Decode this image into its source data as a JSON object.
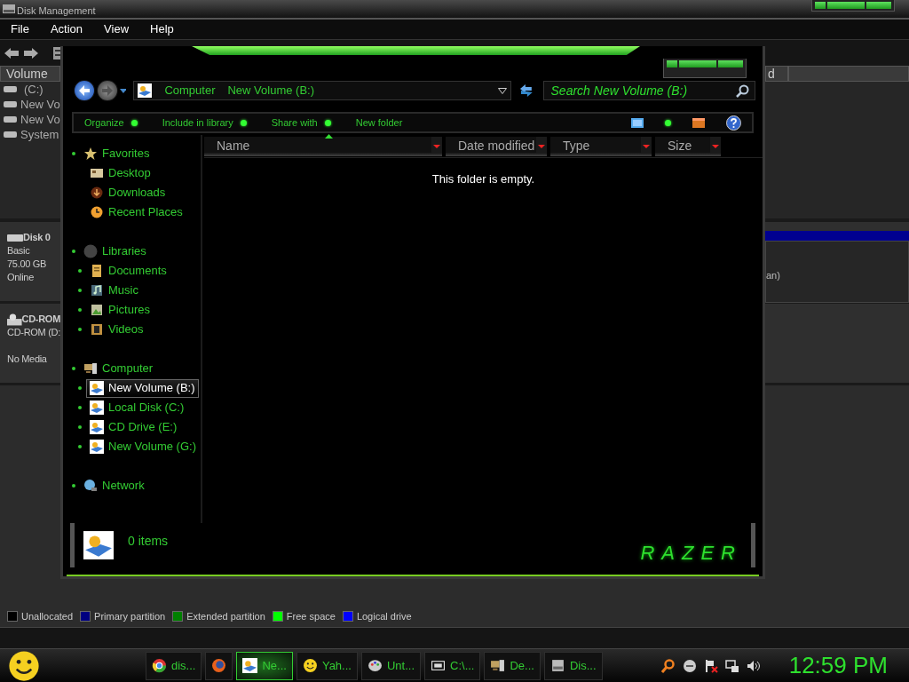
{
  "disk_management": {
    "title": "Disk Management",
    "menu": [
      "File",
      "Action",
      "View",
      "Help"
    ],
    "volume_columns": [
      "Volume",
      "d"
    ],
    "volumes": [
      "(C:)",
      "New Vo",
      "New Vo",
      "System"
    ],
    "disks": [
      {
        "name": "Disk 0",
        "kind": "disk",
        "type": "Basic",
        "size": "75.00 GB",
        "status": "Online",
        "partition_text": "an)"
      },
      {
        "name": "CD-ROM",
        "kind": "cdrom",
        "type": "CD-ROM (D:",
        "status": "No Media"
      }
    ],
    "legend": [
      {
        "label": "Unallocated",
        "color": "#000000"
      },
      {
        "label": "Primary partition",
        "color": "#000080"
      },
      {
        "label": "Extended partition",
        "color": "#008000"
      },
      {
        "label": "Free space",
        "color": "#00ff00"
      },
      {
        "label": "Logical drive",
        "color": "#0000ff"
      }
    ]
  },
  "explorer": {
    "breadcrumb": [
      "Computer",
      "New Volume (B:)"
    ],
    "search": {
      "placeholder": "Search New Volume (B:)"
    },
    "commands": [
      {
        "label": "Organize",
        "menu": true
      },
      {
        "label": "Include in library",
        "menu": true
      },
      {
        "label": "Share with",
        "menu": true
      },
      {
        "label": "New folder",
        "menu": false
      }
    ],
    "nav": [
      {
        "label": "Favorites",
        "kind": "star",
        "expandable": true,
        "selected": false,
        "children": [
          {
            "label": "Desktop",
            "kind": "desktop",
            "expandable": false,
            "selected": false
          },
          {
            "label": "Downloads",
            "kind": "downloads",
            "expandable": false,
            "selected": false
          },
          {
            "label": "Recent Places",
            "kind": "recent",
            "expandable": false,
            "selected": false
          }
        ]
      },
      {
        "label": "Libraries",
        "kind": "library",
        "expandable": true,
        "selected": false,
        "children": [
          {
            "label": "Documents",
            "kind": "documents",
            "expandable": true,
            "selected": false
          },
          {
            "label": "Music",
            "kind": "music",
            "expandable": true,
            "selected": false
          },
          {
            "label": "Pictures",
            "kind": "pictures",
            "expandable": true,
            "selected": false
          },
          {
            "label": "Videos",
            "kind": "videos",
            "expandable": true,
            "selected": false
          }
        ]
      },
      {
        "label": "Computer",
        "kind": "computer",
        "expandable": true,
        "selected": false,
        "children": [
          {
            "label": "New Volume (B:)",
            "kind": "drive",
            "expandable": true,
            "selected": true
          },
          {
            "label": "Local Disk (C:)",
            "kind": "drive",
            "expandable": true,
            "selected": false
          },
          {
            "label": "CD Drive (E:)",
            "kind": "drive",
            "expandable": true,
            "selected": false
          },
          {
            "label": "New Volume (G:)",
            "kind": "drive",
            "expandable": true,
            "selected": false
          }
        ]
      },
      {
        "label": "Network",
        "kind": "network",
        "expandable": true,
        "selected": false
      }
    ],
    "columns": [
      {
        "label": "Name",
        "sorted": true
      },
      {
        "label": "Date modified",
        "sorted": false
      },
      {
        "label": "Type",
        "sorted": false
      },
      {
        "label": "Size",
        "sorted": false
      }
    ],
    "empty_message": "This folder is empty.",
    "status": "0 items",
    "logo": "RAZER"
  },
  "taskbar": {
    "tasks": [
      {
        "label": "dis...",
        "kind": "browser",
        "selected": false
      },
      {
        "kind": "fox",
        "selected": false
      },
      {
        "label": "Ne...",
        "kind": "drive",
        "selected": true
      },
      {
        "label": "Yah...",
        "kind": "smiley",
        "selected": false
      },
      {
        "label": "Unt...",
        "kind": "palette",
        "selected": false
      },
      {
        "label": "C:\\...",
        "kind": "archive",
        "selected": false
      },
      {
        "label": "De...",
        "kind": "computer",
        "selected": false
      },
      {
        "label": "Dis...",
        "kind": "disk",
        "selected": false
      }
    ],
    "clock": "12:59 PM"
  }
}
